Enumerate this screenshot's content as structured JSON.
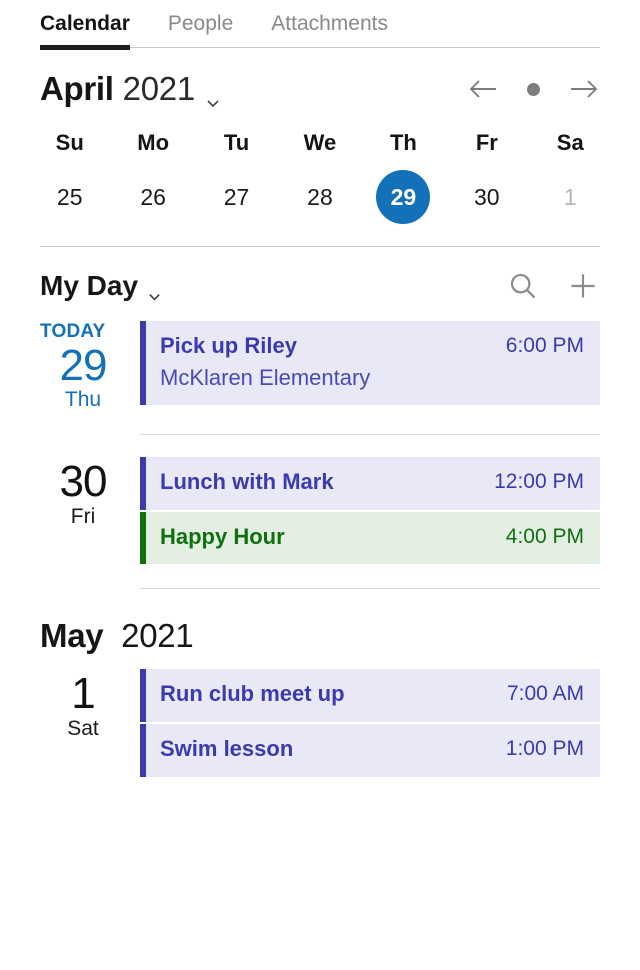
{
  "tabs": [
    {
      "label": "Calendar",
      "active": true
    },
    {
      "label": "People",
      "active": false
    },
    {
      "label": "Attachments",
      "active": false
    }
  ],
  "month_header": {
    "month": "April",
    "year": "2021",
    "dropdown_icon": "chevron-down-icon",
    "prev_icon": "arrow-left-icon",
    "today_icon": "dot-today-icon",
    "next_icon": "arrow-right-icon"
  },
  "week_strip": {
    "day_names": [
      "Su",
      "Mo",
      "Tu",
      "We",
      "Th",
      "Fr",
      "Sa"
    ],
    "days": [
      {
        "num": "25",
        "state": "normal"
      },
      {
        "num": "26",
        "state": "normal"
      },
      {
        "num": "27",
        "state": "normal"
      },
      {
        "num": "28",
        "state": "normal"
      },
      {
        "num": "29",
        "state": "selected"
      },
      {
        "num": "30",
        "state": "normal"
      },
      {
        "num": "1",
        "state": "muted"
      }
    ]
  },
  "list_header": {
    "title": "My Day",
    "dropdown_icon": "chevron-down-icon",
    "search_icon": "search-icon",
    "add_icon": "plus-icon"
  },
  "agenda": {
    "today_label": "TODAY",
    "groups": [
      {
        "day_num": "29",
        "day_name": "Thu",
        "is_today": true,
        "events": [
          {
            "title": "Pick up Riley",
            "location": "McKlaren Elementary",
            "time": "6:00 PM",
            "color": "purple"
          }
        ]
      },
      {
        "day_num": "30",
        "day_name": "Fri",
        "is_today": false,
        "events": [
          {
            "title": "Lunch with Mark",
            "location": "",
            "time": "12:00 PM",
            "color": "purple"
          },
          {
            "title": "Happy Hour",
            "location": "",
            "time": "4:00 PM",
            "color": "green"
          }
        ]
      }
    ],
    "next_month": {
      "month": "May",
      "year": "2021",
      "groups": [
        {
          "day_num": "1",
          "day_name": "Sat",
          "is_today": false,
          "events": [
            {
              "title": "Run club meet up",
              "location": "",
              "time": "7:00 AM",
              "color": "purple"
            },
            {
              "title": "Swim lesson",
              "location": "",
              "time": "1:00 PM",
              "color": "purple"
            }
          ]
        }
      ]
    }
  },
  "colors": {
    "selected_day": "#1271b8",
    "today_text": "#1271b8",
    "event_purple": "#3b3bb0",
    "event_purple_bg": "#e8e8f6",
    "event_green": "#107010",
    "event_green_bg": "#e4efe4",
    "active_tab": "#1e1e1e",
    "inactive_tab": "#8a8a8a"
  }
}
